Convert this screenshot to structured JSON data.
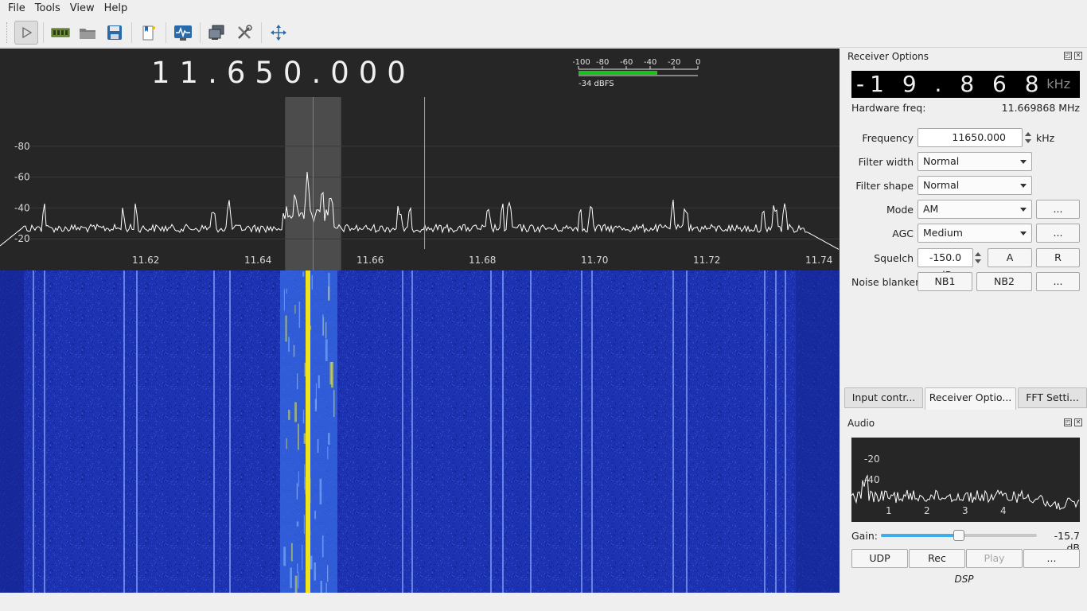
{
  "menu": {
    "file": "File",
    "tools": "Tools",
    "view": "View",
    "help": "Help"
  },
  "toolbar": {
    "icons": [
      "play-icon",
      "hardware-icon",
      "open-icon",
      "save-icon",
      "bookmark-icon",
      "remote-control-icon",
      "network-icon",
      "tools-icon",
      "fullscreen-icon"
    ]
  },
  "display": {
    "frequency": "11.650.000",
    "level_meter": {
      "ticks": [
        "-100",
        "-80",
        "-60",
        "-40",
        "-20",
        "0"
      ],
      "readout": "-34 dBFS",
      "level_dbfs": -34
    },
    "plotter": {
      "y_ticks": [
        "-20",
        "-40",
        "-60",
        "-80"
      ],
      "x_ticks": [
        "11.62",
        "11.64",
        "11.66",
        "11.68",
        "11.70",
        "11.72",
        "11.74"
      ],
      "y_tick_values": [
        -20,
        -40,
        -60,
        -80
      ],
      "x_tick_values": [
        11.62,
        11.64,
        11.66,
        11.68,
        11.7,
        11.72,
        11.74
      ],
      "center_mhz": 11.65,
      "filter_low_mhz": 11.645,
      "filter_high_mhz": 11.655,
      "hw_marker_mhz": 11.669868
    }
  },
  "receiver": {
    "title": "Receiver Options",
    "offset_digits": "-1 9 . 8 6 8",
    "offset_unit": "kHz",
    "hardware_freq_label": "Hardware freq:",
    "hardware_freq_value": "11.669868 MHz",
    "frequency_label": "Frequency",
    "frequency_value": "11650.000",
    "frequency_unit": "kHz",
    "filter_width_label": "Filter width",
    "filter_width_value": "Normal",
    "filter_shape_label": "Filter shape",
    "filter_shape_value": "Normal",
    "mode_label": "Mode",
    "mode_value": "AM",
    "agc_label": "AGC",
    "agc_value": "Medium",
    "squelch_label": "Squelch",
    "squelch_value": "-150.0 dB",
    "squelch_a": "A",
    "squelch_r": "R",
    "noise_blanker_label": "Noise blanker",
    "nb1": "NB1",
    "nb2": "NB2",
    "more": "..."
  },
  "tabs": {
    "input": "Input contr...",
    "receiver": "Receiver Optio...",
    "fft": "FFT Setti..."
  },
  "audio": {
    "title": "Audio",
    "plot_y_ticks": [
      "-20",
      "-40"
    ],
    "plot_x_ticks": [
      "1",
      "2",
      "3",
      "4"
    ],
    "gain_label": "Gain:",
    "gain_value": "-15.7 dB",
    "gain_fraction": 0.5,
    "udp": "UDP",
    "rec": "Rec",
    "play": "Play",
    "more": "...",
    "dsp": "DSP"
  },
  "colors": {
    "trace": "#ffffff",
    "center_line": "#ff4a4a",
    "hw_marker": "#8ca0ff",
    "meter_fill": "#19c419",
    "waterfall": "#1a33b3"
  }
}
